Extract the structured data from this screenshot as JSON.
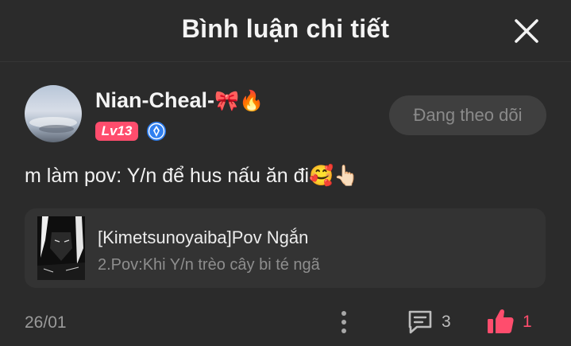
{
  "header": {
    "title": "Bình luận chi tiết",
    "close_icon": "close-icon"
  },
  "user": {
    "name": "Nian-Cheal-",
    "name_emojis": "🎀🔥",
    "level": "Lv13",
    "level_color": "#ff4d6d",
    "vip_icon": "vip-badge-icon"
  },
  "follow": {
    "label": "Đang theo dõi"
  },
  "comment": {
    "text": "m làm pov: Y/n để hus nấu ăn đi🥰👆🏻"
  },
  "story": {
    "title": "[Kimetsunoyaiba]Pov Ngắn",
    "subtitle": "2.Pov:Khi Y/n trèo cây bi té ngã"
  },
  "footer": {
    "date": "26/01",
    "reply_count": "3",
    "like_count": "1",
    "accent": "#ff4d6d"
  }
}
